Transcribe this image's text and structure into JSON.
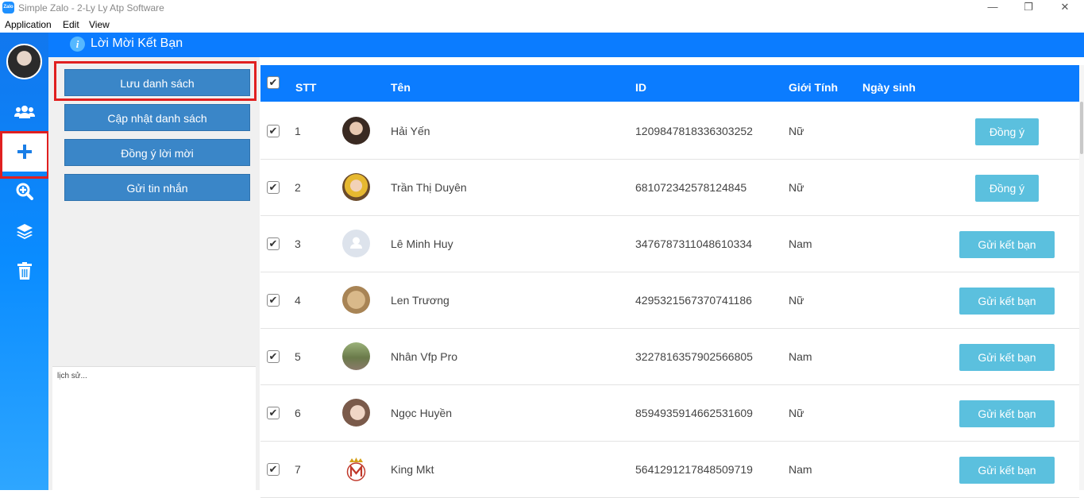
{
  "window": {
    "title": "Simple Zalo - 2-Ly Ly Atp Software",
    "app_icon_text": "Zalo",
    "controls": {
      "minimize": "—",
      "restore": "❐",
      "close": "✕"
    }
  },
  "menu": {
    "items": [
      "Application",
      "Edit",
      "View"
    ]
  },
  "sidebar": {
    "items": [
      {
        "icon": "users-icon"
      },
      {
        "icon": "plus-icon",
        "active": true
      },
      {
        "icon": "search-plus-icon"
      },
      {
        "icon": "layers-icon"
      },
      {
        "icon": "trash-icon"
      }
    ]
  },
  "header": {
    "info_glyph": "i",
    "title": "Lời Mời Kết Bạn"
  },
  "panel": {
    "buttons": [
      "Lưu danh sách",
      "Cập nhật danh sách",
      "Đồng ý lời mời",
      "Gửi tin nhắn"
    ],
    "history_placeholder": "lịch sử..."
  },
  "table": {
    "headers": {
      "stt": "STT",
      "name": "Tên",
      "id": "ID",
      "gender": "Giới Tính",
      "birthday": "Ngày sinh"
    },
    "rows": [
      {
        "stt": "1",
        "name": "Hải Yến",
        "id": "1209847818336303252",
        "gender": "Nữ",
        "action": "Đồng ý",
        "checked": true
      },
      {
        "stt": "2",
        "name": "Trần Thị Duyên",
        "id": "681072342578124845",
        "gender": "Nữ",
        "action": "Đồng ý",
        "checked": true
      },
      {
        "stt": "3",
        "name": "Lê Minh Huy",
        "id": "3476787311048610334",
        "gender": "Nam",
        "action": "Gửi kết bạn",
        "checked": true
      },
      {
        "stt": "4",
        "name": "Len Trương",
        "id": "4295321567370741186",
        "gender": "Nữ",
        "action": "Gửi kết bạn",
        "checked": true
      },
      {
        "stt": "5",
        "name": "Nhân Vfp Pro",
        "id": "3227816357902566805",
        "gender": "Nam",
        "action": "Gửi kết bạn",
        "checked": true
      },
      {
        "stt": "6",
        "name": "Ngọc Huyền",
        "id": "8594935914662531609",
        "gender": "Nữ",
        "action": "Gửi kết bạn",
        "checked": true
      },
      {
        "stt": "7",
        "name": "King Mkt",
        "id": "5641291217848509719",
        "gender": "Nam",
        "action": "Gửi kết bạn",
        "checked": true
      }
    ]
  },
  "colors": {
    "accent": "#0b7cff",
    "button": "#3a86c8",
    "action": "#5bc0de",
    "highlight": "#e02020"
  }
}
